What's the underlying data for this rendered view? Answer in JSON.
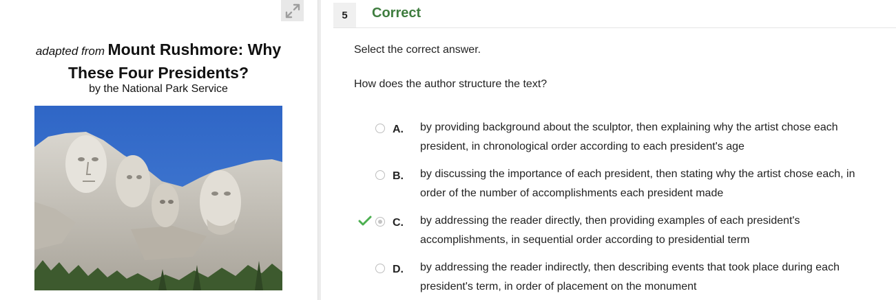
{
  "passage": {
    "adapted_prefix": "adapted from",
    "title": "Mount Rushmore: Why These Four Presidents?",
    "byline": "by the National Park Service",
    "expand_icon": "expand-arrows-icon",
    "image_subject": "Mount Rushmore sculpture photo"
  },
  "question": {
    "number": "5",
    "status": "Correct",
    "status_color": "#3f7d3f",
    "instruction": "Select the correct answer.",
    "prompt": "How does the author structure the text?",
    "options": [
      {
        "letter": "A.",
        "text": "by providing background about the sculptor, then explaining why the artist chose each president, in chronological order according to each president's age",
        "selected": false,
        "correct": false
      },
      {
        "letter": "B.",
        "text": "by discussing the importance of each president, then stating why the artist chose each, in order of the number of accomplishments each president made",
        "selected": false,
        "correct": false
      },
      {
        "letter": "C.",
        "text": "by addressing the reader directly, then providing examples of each president's accomplishments, in sequential order according to presidential term",
        "selected": true,
        "correct": true
      },
      {
        "letter": "D.",
        "text": "by addressing the reader indirectly, then describing events that took place during each president's term, in order of placement on the monument",
        "selected": false,
        "correct": false
      }
    ]
  }
}
